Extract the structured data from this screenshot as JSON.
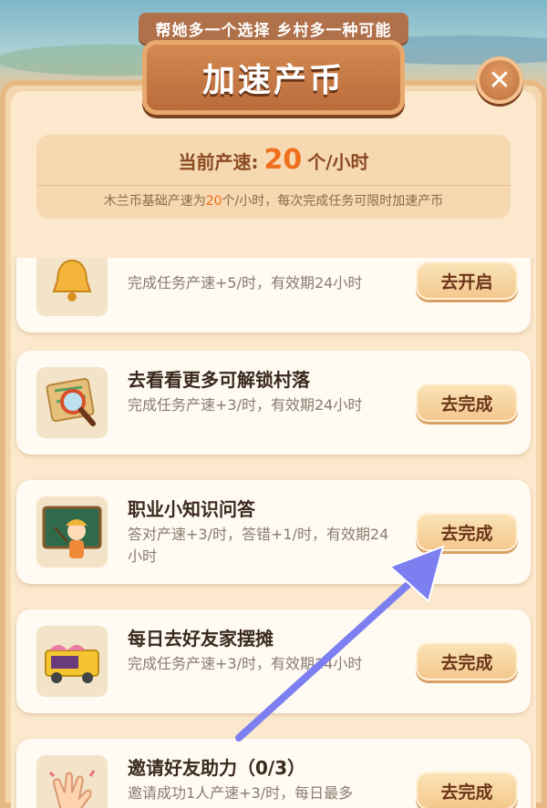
{
  "header": {
    "subtitle": "帮她多一个选择 乡村多一种可能",
    "title": "加速产币",
    "close_symbol": "✕"
  },
  "speed": {
    "prefix": "当前产速:",
    "value": "20",
    "unit": "个/小时",
    "note_pre": "木兰币基础产速为",
    "note_value": "20",
    "note_post": "个/小时，每次完成任务可限时加速产币"
  },
  "tasks": [
    {
      "title": "",
      "desc": "完成任务产速+5/时，有效期24小时",
      "button": "去开启",
      "icon": "alarm-bell-icon"
    },
    {
      "title": "去看看更多可解锁村落",
      "desc": "完成任务产速+3/时，有效期24小时",
      "button": "去完成",
      "icon": "map-magnifier-icon"
    },
    {
      "title": "职业小知识问答",
      "desc": "答对产速+3/时，答错+1/时，有效期24小时",
      "button": "去完成",
      "icon": "teacher-blackboard-icon"
    },
    {
      "title": "每日去好友家摆摊",
      "desc": "完成任务产速+3/时，有效期24小时",
      "button": "去完成",
      "icon": "food-truck-icon"
    },
    {
      "title": "邀请好友助力（0/3）",
      "desc": "邀请成功1人产速+3/时，每日最多",
      "button": "去完成",
      "icon": "clapping-hands-icon"
    }
  ],
  "colors": {
    "accent": "#ef6f1e",
    "arrow": "#7b7ff0"
  }
}
